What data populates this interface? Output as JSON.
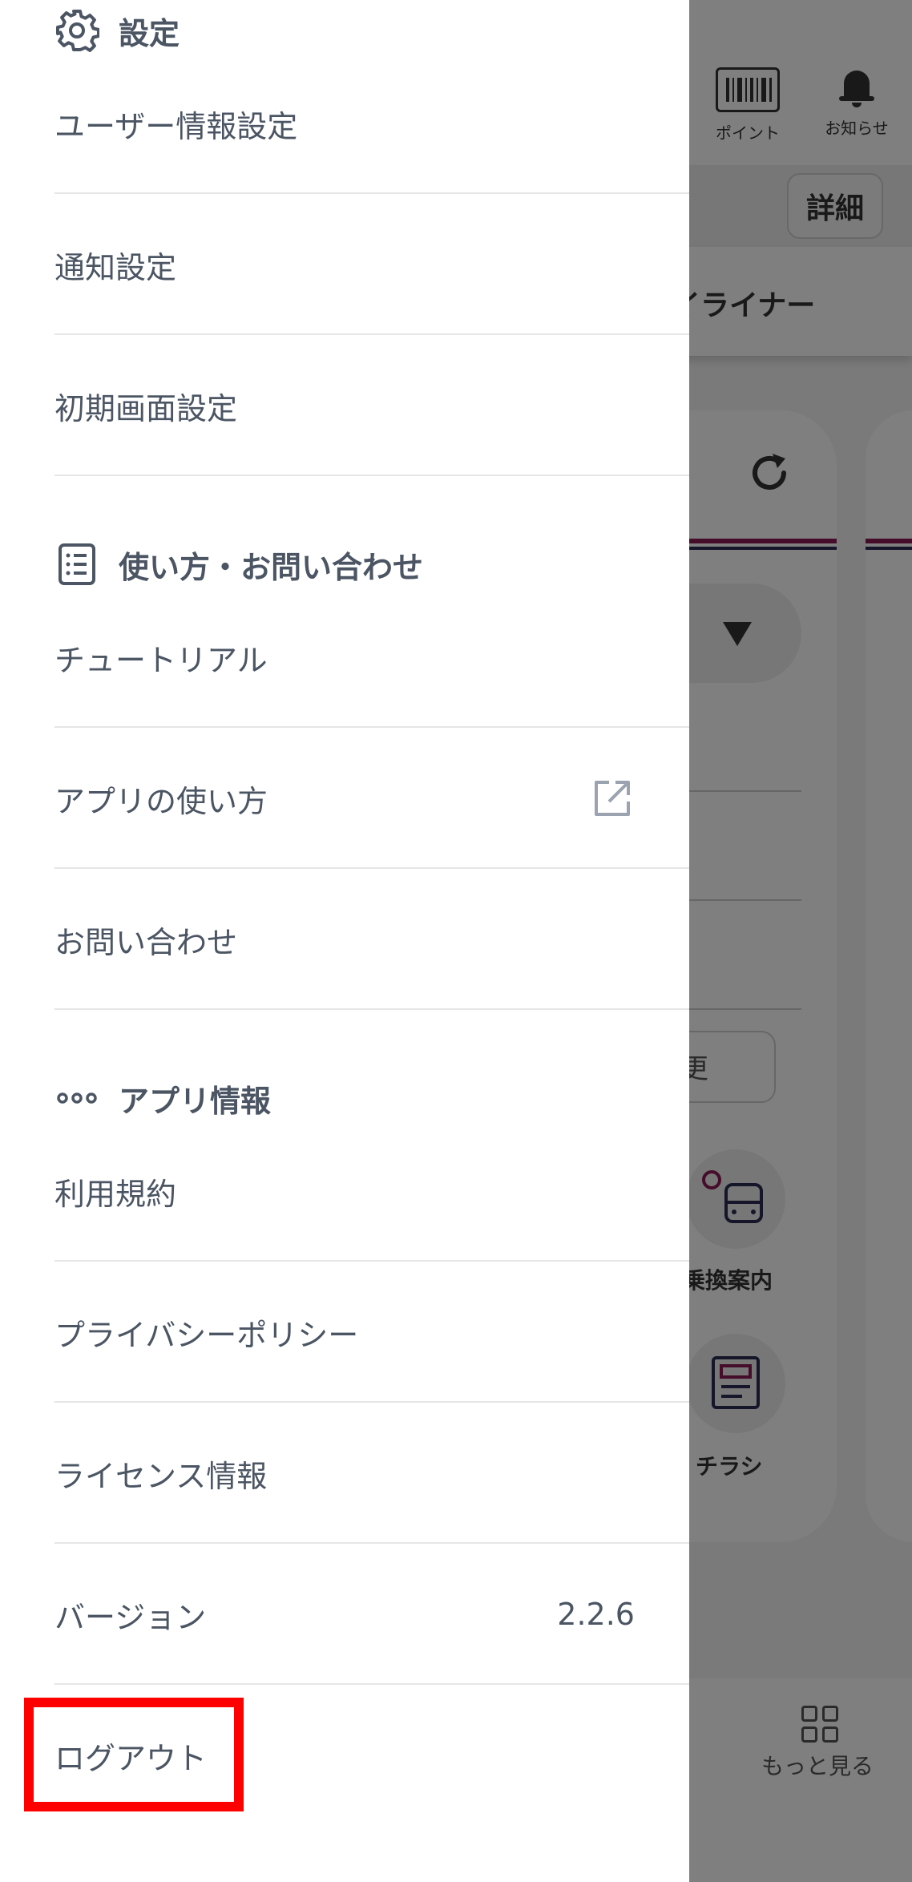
{
  "background": {
    "header": {
      "point_label": "ポイント",
      "notice_label": "お知らせ"
    },
    "detail_button": "詳細",
    "tab_text": "イライナー",
    "icons": [
      {
        "label": "乗換案内",
        "icon": "route-train-icon"
      },
      {
        "label": "チラシ",
        "icon": "flyer-icon"
      }
    ],
    "button_fragment": "更",
    "footer": {
      "more_label": "もっと見る"
    },
    "colors": {
      "stripe_primary": "#8a1a52",
      "stripe_secondary": "#2c2c54"
    }
  },
  "drawer": {
    "sections": [
      {
        "title": "設定",
        "icon": "gear-icon",
        "items": [
          {
            "label": "ユーザー情報設定"
          },
          {
            "label": "通知設定"
          },
          {
            "label": "初期画面設定"
          }
        ]
      },
      {
        "title": "使い方・お問い合わせ",
        "icon": "document-list-icon",
        "items": [
          {
            "label": "チュートリアル"
          },
          {
            "label": "アプリの使い方",
            "external": true
          },
          {
            "label": "お問い合わせ"
          }
        ]
      },
      {
        "title": "アプリ情報",
        "icon": "more-dots-icon",
        "items": [
          {
            "label": "利用規約"
          },
          {
            "label": "プライバシーポリシー"
          },
          {
            "label": "ライセンス情報"
          },
          {
            "label": "バージョン",
            "value": "2.2.6"
          },
          {
            "label": "ログアウト",
            "highlighted": true
          }
        ]
      }
    ]
  },
  "colors": {
    "text": "#4b5563",
    "highlight": "#ff0000",
    "divider": "#e6e6e6"
  }
}
